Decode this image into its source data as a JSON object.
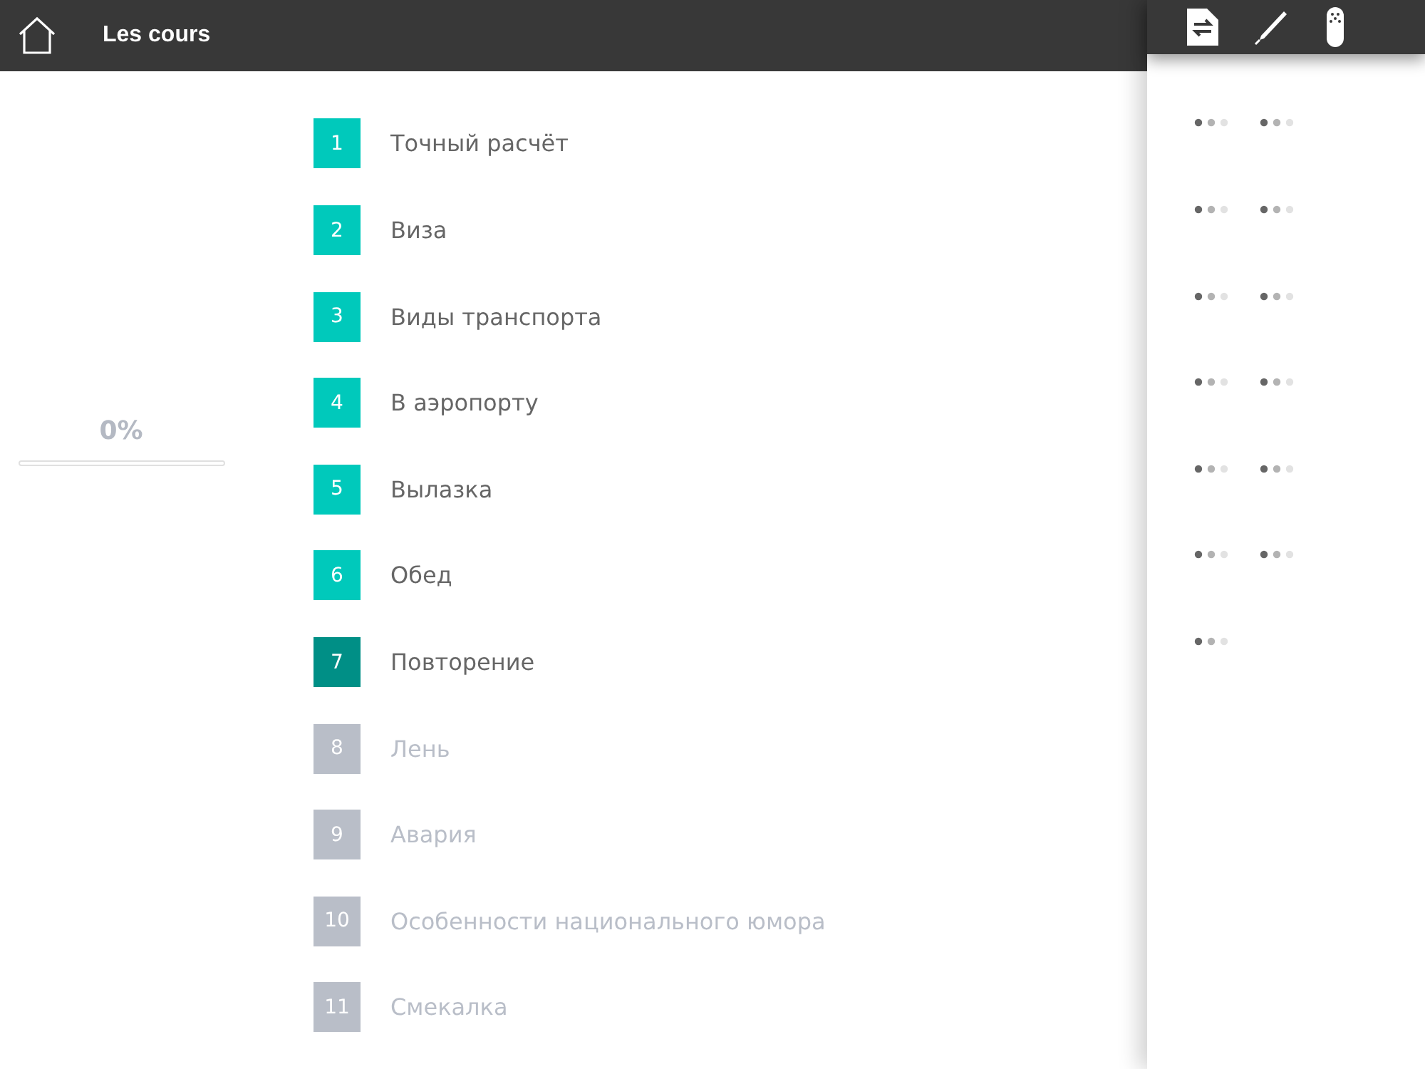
{
  "header": {
    "title": "Les cours"
  },
  "progress": {
    "label": "0%",
    "level": 0
  },
  "lessons": [
    {
      "number": "1",
      "title": "Точный расчёт",
      "kind": "open",
      "exercises": [
        {
          "kind": "dots"
        },
        {
          "kind": "dots"
        }
      ]
    },
    {
      "number": "2",
      "title": "Виза",
      "kind": "open",
      "exercises": [
        {
          "kind": "dots"
        },
        {
          "kind": "dots"
        }
      ]
    },
    {
      "number": "3",
      "title": "Виды транспорта",
      "kind": "open",
      "exercises": [
        {
          "kind": "dots"
        },
        {
          "kind": "dots"
        }
      ]
    },
    {
      "number": "4",
      "title": "В аэропорту",
      "kind": "open",
      "exercises": [
        {
          "kind": "dots"
        },
        {
          "kind": "dots"
        }
      ]
    },
    {
      "number": "5",
      "title": "Вылазка",
      "kind": "open",
      "exercises": [
        {
          "kind": "dots"
        },
        {
          "kind": "dots"
        }
      ]
    },
    {
      "number": "6",
      "title": "Обед",
      "kind": "open",
      "exercises": [
        {
          "kind": "dots"
        },
        {
          "kind": "dots"
        }
      ]
    },
    {
      "number": "7",
      "title": "Повторение",
      "kind": "current",
      "exercises": [
        {
          "kind": "dots"
        }
      ]
    },
    {
      "number": "8",
      "title": "Лень",
      "kind": "locked"
    },
    {
      "number": "9",
      "title": "Авария",
      "kind": "locked"
    },
    {
      "number": "10",
      "title": "Особенности национального юмора",
      "kind": "locked"
    },
    {
      "number": "11",
      "title": "Смекалка",
      "kind": "locked"
    }
  ]
}
